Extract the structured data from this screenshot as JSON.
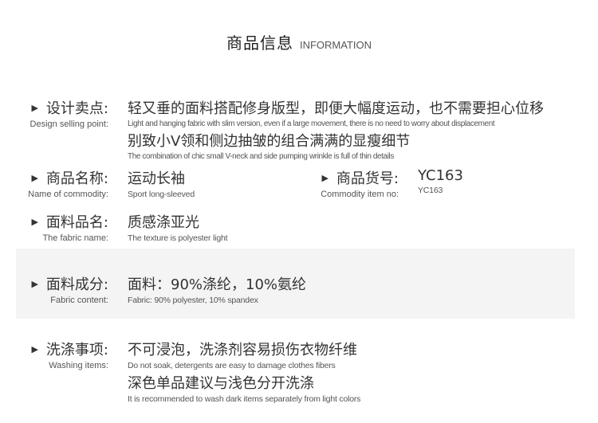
{
  "header": {
    "title_zh": "商品信息",
    "title_en": "INFORMATION"
  },
  "selling": {
    "label_zh": "设计卖点:",
    "label_en": "Design selling point:",
    "line1_zh": "轻又垂的面料搭配修身版型，即便大幅度运动，也不需要担心位移",
    "line1_en": "Light and hanging fabric with slim version, even if a large movement, there is no need to worry about displacement",
    "line2_zh": "别致小V领和侧边抽皱的组合满满的显瘦细节",
    "line2_en": "The combination of chic small V-neck and side pumping wrinkle is full of thin details"
  },
  "name": {
    "label_zh": "商品名称:",
    "label_en": "Name of commodity:",
    "value_zh": "运动长袖",
    "value_en": "Sport long-sleeved"
  },
  "item_no": {
    "label_zh": "商品货号:",
    "label_en": "Commodity item no:",
    "value_zh": "YC163",
    "value_en": "YC163"
  },
  "fabric_name": {
    "label_zh": "面料品名:",
    "label_en": "The fabric name:",
    "value_zh": "质感涤亚光",
    "value_en": "The texture is polyester light"
  },
  "fabric_content": {
    "label_zh": "面料成分:",
    "label_en": "Fabric content:",
    "value_zh": "面料：90%涤纶，10%氨纶",
    "value_en": "Fabric: 90% polyester, 10% spandex"
  },
  "washing": {
    "label_zh": "洗涤事项:",
    "label_en": "Washing items:",
    "line1_zh": "不可浸泡，洗涤剂容易损伤衣物纤维",
    "line1_en": "Do not soak, detergents are easy to damage clothes fibers",
    "line2_zh": "深色单品建议与浅色分开洗涤",
    "line2_en": "It is recommended to wash dark items separately from light colors"
  },
  "icons": {
    "bullet": "triangle-right-icon",
    "bullet_glyph": "▶"
  }
}
